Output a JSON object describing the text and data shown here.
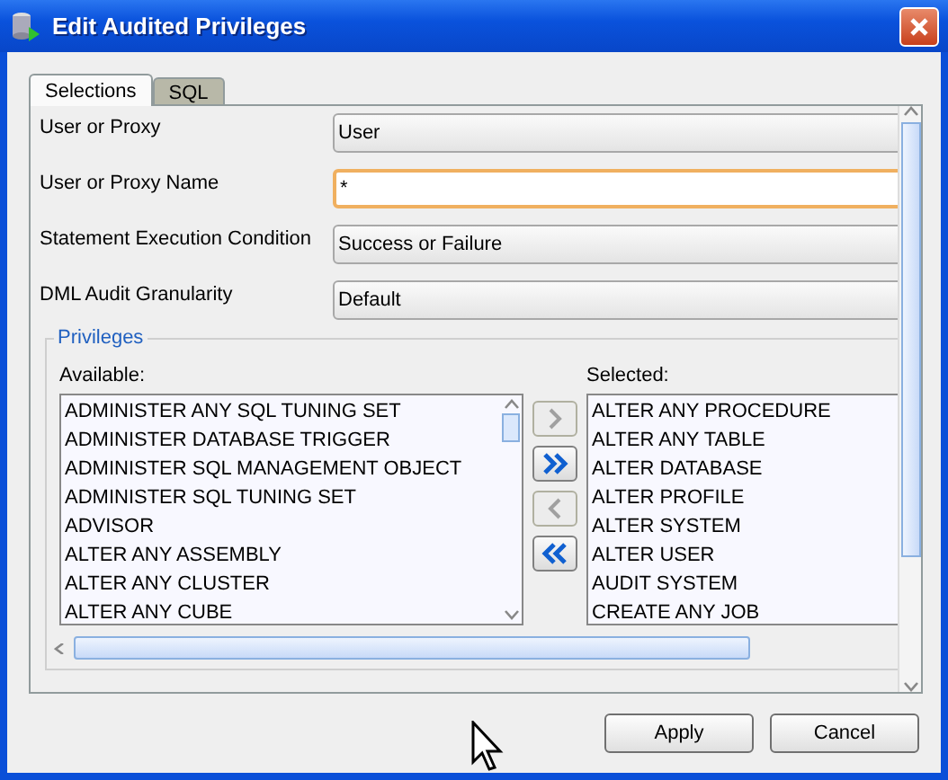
{
  "window": {
    "title": "Edit Audited Privileges"
  },
  "tabs": [
    {
      "label": "Selections",
      "selected": true
    },
    {
      "label": "SQL",
      "selected": false
    }
  ],
  "fields": [
    {
      "label": "User or Proxy",
      "kind": "dropdown",
      "value": "User",
      "focused": false
    },
    {
      "label": "User or Proxy Name",
      "kind": "text",
      "value": "*",
      "focused": true
    },
    {
      "label": "Statement Execution Condition",
      "kind": "dropdown",
      "value": "Success or Failure",
      "focused": false
    },
    {
      "label": "DML Audit Granularity",
      "kind": "dropdown",
      "value": "Default",
      "focused": false
    }
  ],
  "privileges": {
    "title": "Privileges",
    "available_label": "Available:",
    "selected_label": "Selected:",
    "available": [
      "ADMINISTER ANY SQL TUNING SET",
      "ADMINISTER DATABASE TRIGGER",
      "ADMINISTER SQL MANAGEMENT OBJECT",
      "ADMINISTER SQL TUNING SET",
      "ADVISOR",
      "ALTER ANY ASSEMBLY",
      "ALTER ANY CLUSTER",
      "ALTER ANY CUBE"
    ],
    "selected": [
      "ALTER ANY PROCEDURE",
      "ALTER ANY TABLE",
      "ALTER DATABASE",
      "ALTER PROFILE",
      "ALTER SYSTEM",
      "ALTER USER",
      "AUDIT SYSTEM",
      "CREATE ANY JOB"
    ],
    "move_buttons": [
      {
        "kind": "add",
        "disabled": true
      },
      {
        "kind": "add_all",
        "disabled": false
      },
      {
        "kind": "remove",
        "disabled": true
      },
      {
        "kind": "remove_all",
        "disabled": false
      }
    ]
  },
  "buttons": [
    {
      "label": "Apply"
    },
    {
      "label": "Cancel"
    }
  ]
}
